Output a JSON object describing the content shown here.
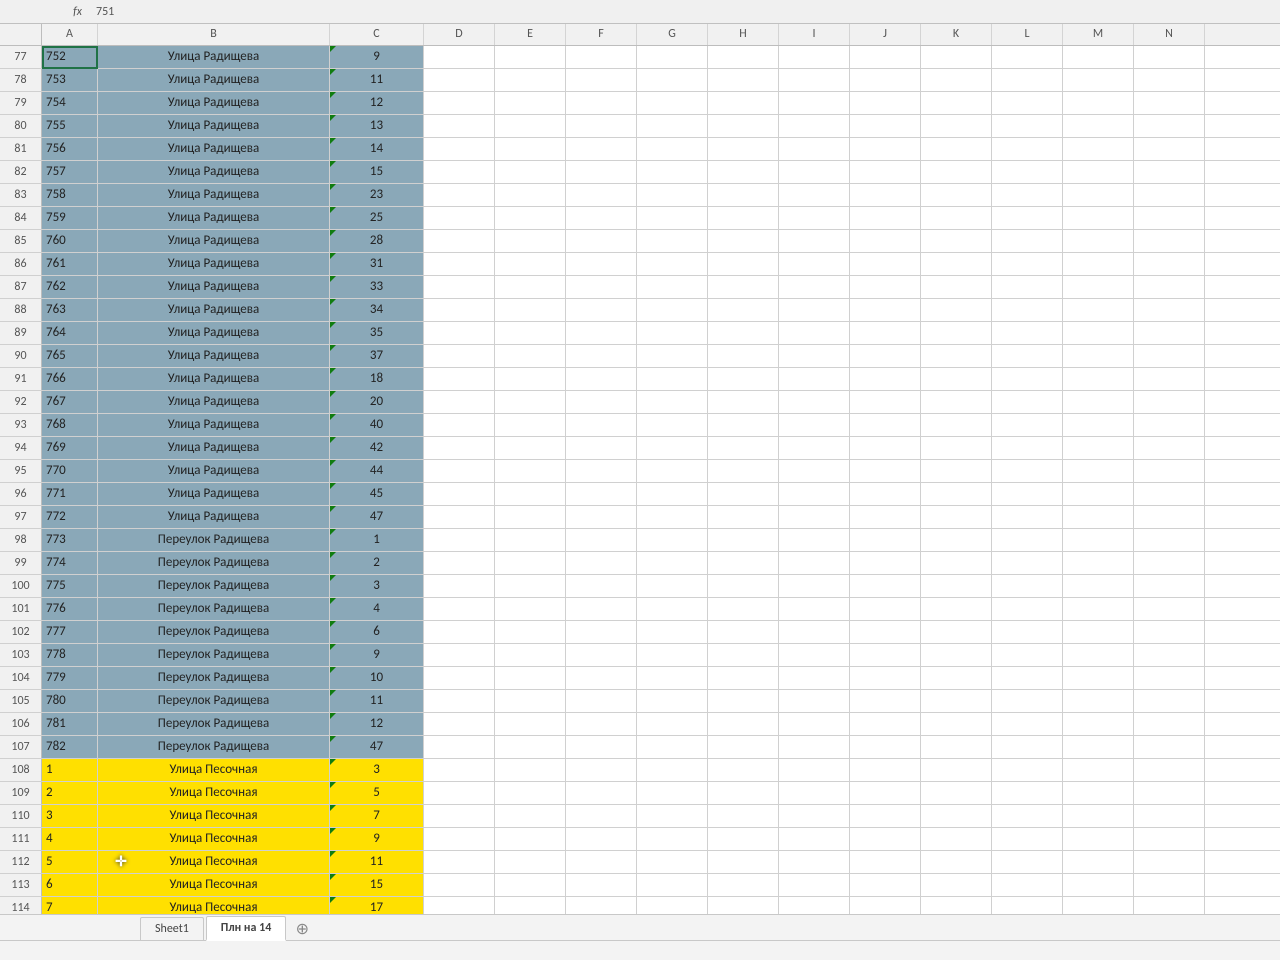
{
  "formula_bar": {
    "fx_label": "fx",
    "value": "751"
  },
  "columns": [
    "A",
    "B",
    "C",
    "D",
    "E",
    "F",
    "G",
    "H",
    "I",
    "J",
    "K",
    "L",
    "M",
    "N"
  ],
  "rows": [
    {
      "rownum": 77,
      "a": "752",
      "b": "Улица Радищева",
      "c": "9",
      "fill": "blue"
    },
    {
      "rownum": 78,
      "a": "753",
      "b": "Улица Радищева",
      "c": "11",
      "fill": "blue"
    },
    {
      "rownum": 79,
      "a": "754",
      "b": "Улица Радищева",
      "c": "12",
      "fill": "blue"
    },
    {
      "rownum": 80,
      "a": "755",
      "b": "Улица Радищева",
      "c": "13",
      "fill": "blue"
    },
    {
      "rownum": 81,
      "a": "756",
      "b": "Улица Радищева",
      "c": "14",
      "fill": "blue"
    },
    {
      "rownum": 82,
      "a": "757",
      "b": "Улица Радищева",
      "c": "15",
      "fill": "blue"
    },
    {
      "rownum": 83,
      "a": "758",
      "b": "Улица Радищева",
      "c": "23",
      "fill": "blue"
    },
    {
      "rownum": 84,
      "a": "759",
      "b": "Улица Радищева",
      "c": "25",
      "fill": "blue"
    },
    {
      "rownum": 85,
      "a": "760",
      "b": "Улица Радищева",
      "c": "28",
      "fill": "blue"
    },
    {
      "rownum": 86,
      "a": "761",
      "b": "Улица Радищева",
      "c": "31",
      "fill": "blue"
    },
    {
      "rownum": 87,
      "a": "762",
      "b": "Улица Радищева",
      "c": "33",
      "fill": "blue"
    },
    {
      "rownum": 88,
      "a": "763",
      "b": "Улица Радищева",
      "c": "34",
      "fill": "blue"
    },
    {
      "rownum": 89,
      "a": "764",
      "b": "Улица Радищева",
      "c": "35",
      "fill": "blue"
    },
    {
      "rownum": 90,
      "a": "765",
      "b": "Улица Радищева",
      "c": "37",
      "fill": "blue"
    },
    {
      "rownum": 91,
      "a": "766",
      "b": "Улица Радищева",
      "c": "18",
      "fill": "blue"
    },
    {
      "rownum": 92,
      "a": "767",
      "b": "Улица Радищева",
      "c": "20",
      "fill": "blue"
    },
    {
      "rownum": 93,
      "a": "768",
      "b": "Улица Радищева",
      "c": "40",
      "fill": "blue"
    },
    {
      "rownum": 94,
      "a": "769",
      "b": "Улица Радищева",
      "c": "42",
      "fill": "blue"
    },
    {
      "rownum": 95,
      "a": "770",
      "b": "Улица Радищева",
      "c": "44",
      "fill": "blue"
    },
    {
      "rownum": 96,
      "a": "771",
      "b": "Улица Радищева",
      "c": "45",
      "fill": "blue"
    },
    {
      "rownum": 97,
      "a": "772",
      "b": "Улица Радищева",
      "c": "47",
      "fill": "blue"
    },
    {
      "rownum": 98,
      "a": "773",
      "b": "Переулок Радищева",
      "c": "1",
      "fill": "blue"
    },
    {
      "rownum": 99,
      "a": "774",
      "b": "Переулок Радищева",
      "c": "2",
      "fill": "blue"
    },
    {
      "rownum": 100,
      "a": "775",
      "b": "Переулок Радищева",
      "c": "3",
      "fill": "blue"
    },
    {
      "rownum": 101,
      "a": "776",
      "b": "Переулок Радищева",
      "c": "4",
      "fill": "blue"
    },
    {
      "rownum": 102,
      "a": "777",
      "b": "Переулок Радищева",
      "c": "6",
      "fill": "blue"
    },
    {
      "rownum": 103,
      "a": "778",
      "b": "Переулок Радищева",
      "c": "9",
      "fill": "blue"
    },
    {
      "rownum": 104,
      "a": "779",
      "b": "Переулок Радищева",
      "c": "10",
      "fill": "blue"
    },
    {
      "rownum": 105,
      "a": "780",
      "b": "Переулок Радищева",
      "c": "11",
      "fill": "blue"
    },
    {
      "rownum": 106,
      "a": "781",
      "b": "Переулок Радищева",
      "c": "12",
      "fill": "blue"
    },
    {
      "rownum": 107,
      "a": "782",
      "b": "Переулок Радищева",
      "c": "47",
      "fill": "blue"
    },
    {
      "rownum": 108,
      "a": "1",
      "b": "Улица Песочная",
      "c": "3",
      "fill": "yellow"
    },
    {
      "rownum": 109,
      "a": "2",
      "b": "Улица Песочная",
      "c": "5",
      "fill": "yellow"
    },
    {
      "rownum": 110,
      "a": "3",
      "b": "Улица Песочная",
      "c": "7",
      "fill": "yellow"
    },
    {
      "rownum": 111,
      "a": "4",
      "b": "Улица Песочная",
      "c": "9",
      "fill": "yellow"
    },
    {
      "rownum": 112,
      "a": "5",
      "b": "Улица Песочная",
      "c": "11",
      "fill": "yellow",
      "cursor": true
    },
    {
      "rownum": 113,
      "a": "6",
      "b": "Улица Песочная",
      "c": "15",
      "fill": "yellow"
    },
    {
      "rownum": 114,
      "a": "7",
      "b": "Улица Песочная",
      "c": "17",
      "fill": "yellow"
    }
  ],
  "tabs": {
    "items": [
      {
        "label": "Sheet1",
        "active": false
      },
      {
        "label": "Плн на 14",
        "active": true
      }
    ],
    "add_icon": "⊕"
  }
}
